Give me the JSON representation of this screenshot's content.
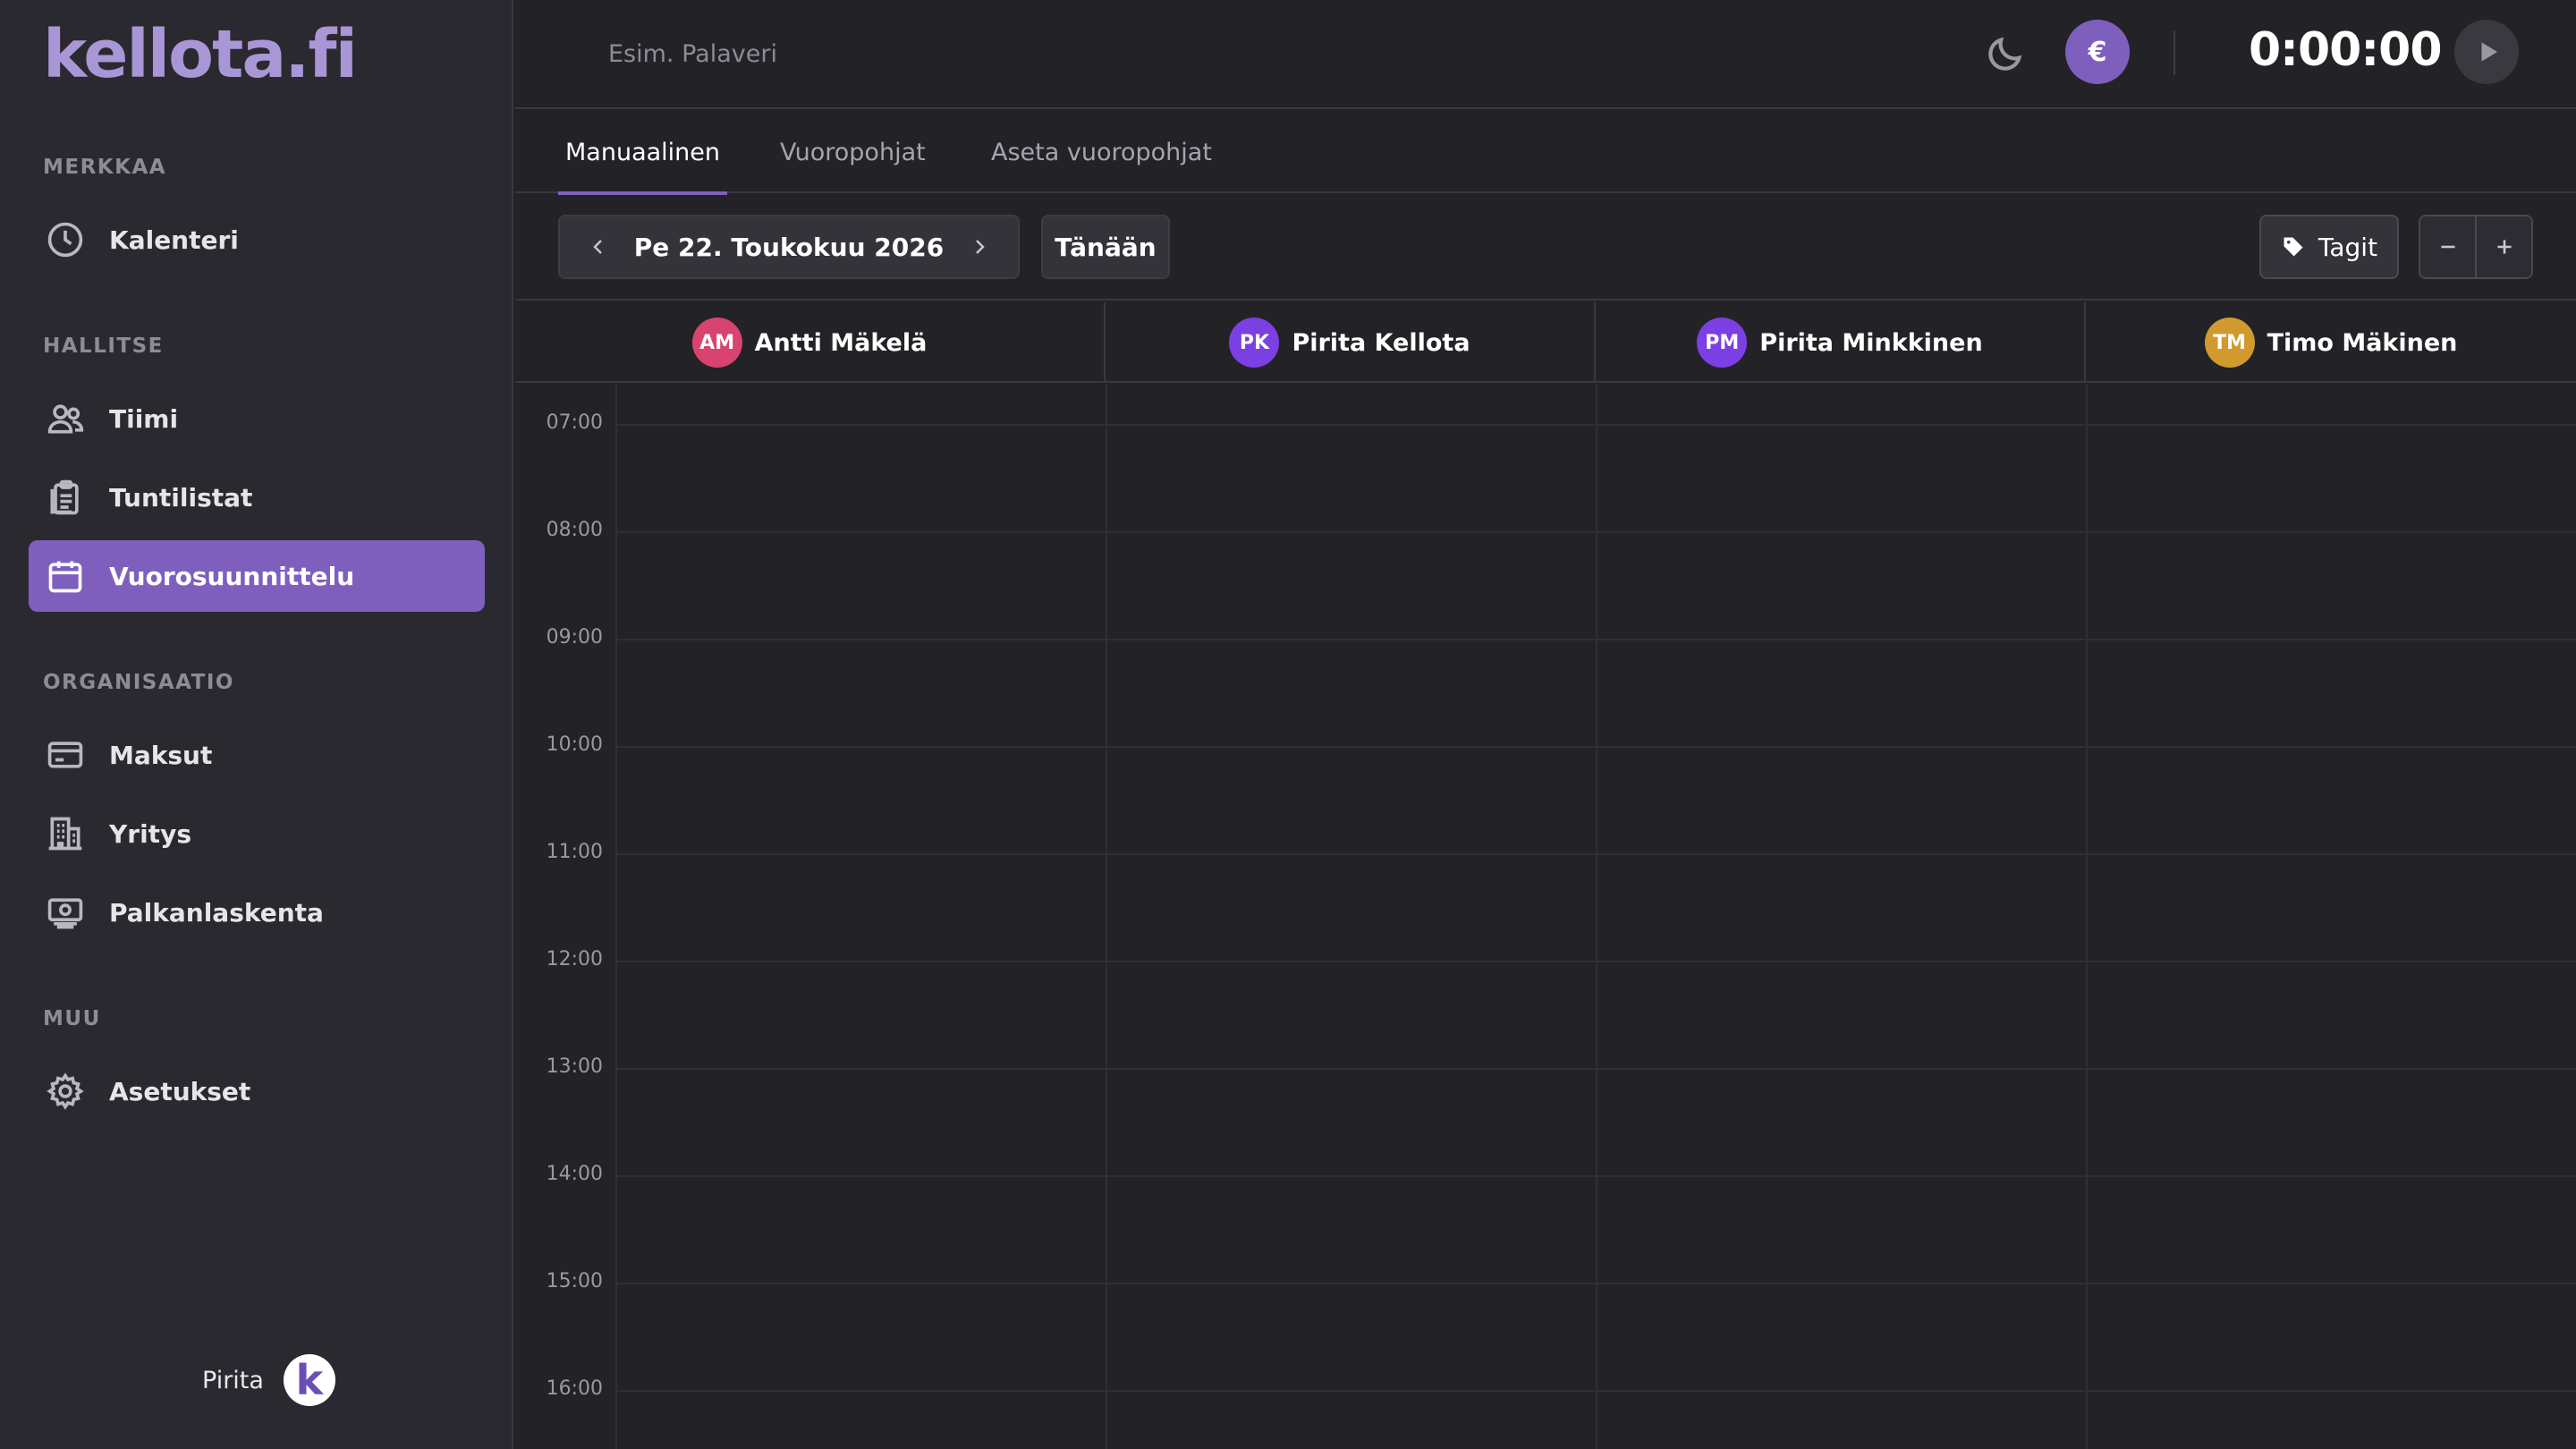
{
  "app": {
    "logo_text": "kellota.fi"
  },
  "sidebar": {
    "sections": [
      {
        "label": "MERKKAA"
      },
      {
        "label": "HALLITSE"
      },
      {
        "label": "ORGANISAATIO"
      },
      {
        "label": "MUU"
      }
    ],
    "items": [
      {
        "label": "Kalenteri",
        "icon": "clock-icon",
        "active": false
      },
      {
        "label": "Tiimi",
        "icon": "users-icon",
        "active": false
      },
      {
        "label": "Tuntilistat",
        "icon": "clipboard-icon",
        "active": false
      },
      {
        "label": "Vuorosuunnittelu",
        "icon": "calendar-icon",
        "active": true
      },
      {
        "label": "Maksut",
        "icon": "credit-card-icon",
        "active": false
      },
      {
        "label": "Yritys",
        "icon": "building-icon",
        "active": false
      },
      {
        "label": "Palkanlaskenta",
        "icon": "money-icon",
        "active": false
      },
      {
        "label": "Asetukset",
        "icon": "gear-icon",
        "active": false
      }
    ],
    "user": {
      "name": "Pirita",
      "avatar_letter": "k"
    }
  },
  "topbar": {
    "search_placeholder": "Esim. Palaveri",
    "currency_symbol": "€",
    "timer": "0:00:00"
  },
  "tabs": [
    {
      "label": "Manuaalinen",
      "active": true
    },
    {
      "label": "Vuoropohjat",
      "active": false
    },
    {
      "label": "Aseta vuoropohjat",
      "active": false
    }
  ],
  "toolbar": {
    "date_label": "Pe 22. Toukokuu 2026",
    "today_label": "Tänään",
    "tags_label": "Tagit"
  },
  "calendar": {
    "employees": [
      {
        "initials": "AM",
        "name": "Antti Mäkelä",
        "color": "#d8436f"
      },
      {
        "initials": "PK",
        "name": "Pirita Kellota",
        "color": "#7b3fe4"
      },
      {
        "initials": "PM",
        "name": "Pirita Minkkinen",
        "color": "#7b3fe4"
      },
      {
        "initials": "TM",
        "name": "Timo Mäkinen",
        "color": "#d09a2e"
      }
    ],
    "hours": [
      "07:00",
      "08:00",
      "09:00",
      "10:00",
      "11:00",
      "12:00",
      "13:00",
      "14:00",
      "15:00",
      "16:00"
    ]
  },
  "colors": {
    "accent": "#7f5fbe",
    "background": "#232227",
    "sidebar": "#2a292f"
  }
}
